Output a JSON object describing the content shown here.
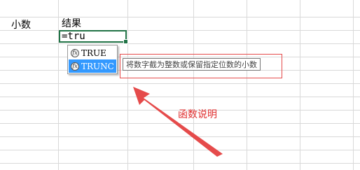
{
  "cells": {
    "header_a": "小数",
    "header_b": "结果"
  },
  "formula": {
    "value": "=tru"
  },
  "autocomplete": {
    "icon": "fx-icon",
    "items": [
      {
        "label": "TRUE",
        "selected": false
      },
      {
        "label": "TRUNC",
        "selected": true
      }
    ]
  },
  "tooltip": {
    "text": "将数字截为整数或保留指定位数的小数"
  },
  "annotation": {
    "text": "函数说明",
    "color": "#e02f2f"
  },
  "colors": {
    "grid": "#d4d4d4",
    "active_border": "#217346",
    "selection": "#3399ff",
    "annotation_red": "#e54b4b"
  }
}
